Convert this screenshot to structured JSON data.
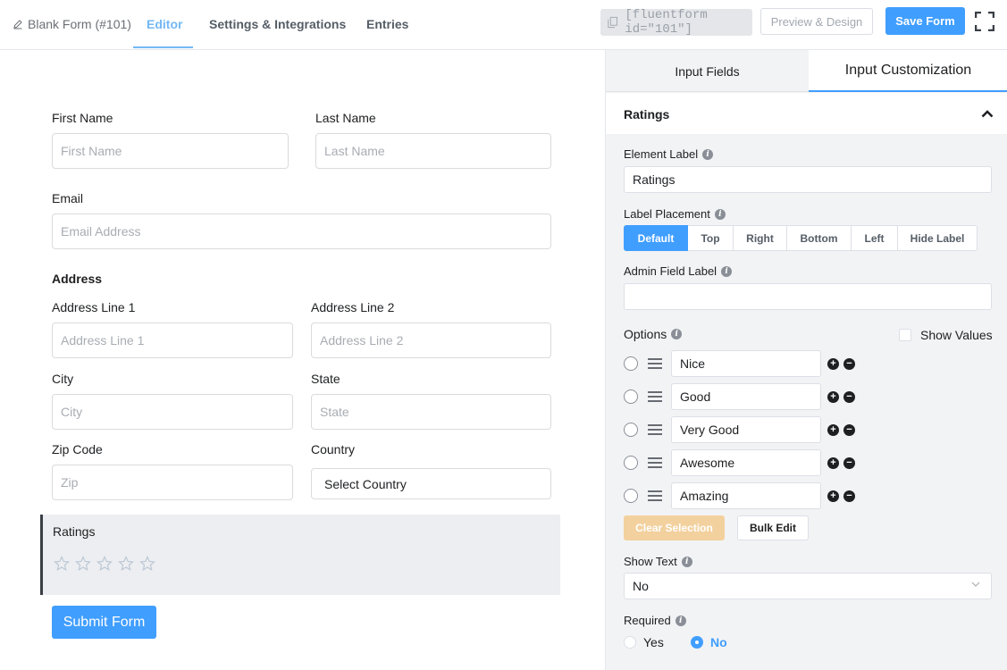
{
  "header": {
    "form_title": "Blank Form (#101)",
    "tabs": [
      {
        "label": "Editor",
        "active": true
      },
      {
        "label": "Settings & Integrations",
        "active": false
      },
      {
        "label": "Entries",
        "active": false
      }
    ],
    "shortcode": "[fluentform id=\"101\"]",
    "preview_label": "Preview & Design",
    "save_label": "Save Form"
  },
  "form": {
    "first_name": {
      "label": "First Name",
      "placeholder": "First Name"
    },
    "last_name": {
      "label": "Last Name",
      "placeholder": "Last Name"
    },
    "email": {
      "label": "Email",
      "placeholder": "Email Address"
    },
    "address": {
      "title": "Address",
      "line1": {
        "label": "Address Line 1",
        "placeholder": "Address Line 1"
      },
      "line2": {
        "label": "Address Line 2",
        "placeholder": "Address Line 2"
      },
      "city": {
        "label": "City",
        "placeholder": "City"
      },
      "state": {
        "label": "State",
        "placeholder": "State"
      },
      "zip": {
        "label": "Zip Code",
        "placeholder": "Zip"
      },
      "country": {
        "label": "Country",
        "value": "Select Country"
      }
    },
    "ratings": {
      "label": "Ratings",
      "stars": 5,
      "selected": 0
    },
    "submit_label": "Submit Form"
  },
  "panel": {
    "tabs": [
      {
        "label": "Input Fields",
        "active": false
      },
      {
        "label": "Input Customization",
        "active": true
      }
    ],
    "section_title": "Ratings",
    "element_label": {
      "label": "Element Label",
      "value": "Ratings"
    },
    "label_placement": {
      "label": "Label Placement",
      "options": [
        "Default",
        "Top",
        "Right",
        "Bottom",
        "Left",
        "Hide Label"
      ],
      "selected": "Default"
    },
    "admin_field_label": {
      "label": "Admin Field Label",
      "value": ""
    },
    "options": {
      "label": "Options",
      "show_values_label": "Show Values",
      "items": [
        "Nice",
        "Good",
        "Very Good",
        "Awesome",
        "Amazing"
      ]
    },
    "clear_selection_label": "Clear Selection",
    "bulk_edit_label": "Bulk Edit",
    "show_text": {
      "label": "Show Text",
      "value": "No"
    },
    "required": {
      "label": "Required",
      "options": [
        "Yes",
        "No"
      ],
      "selected": "No"
    }
  },
  "colors": {
    "accent": "#409eff",
    "tab_active": "#73b8f4",
    "clear_button": "#f3d19e"
  }
}
